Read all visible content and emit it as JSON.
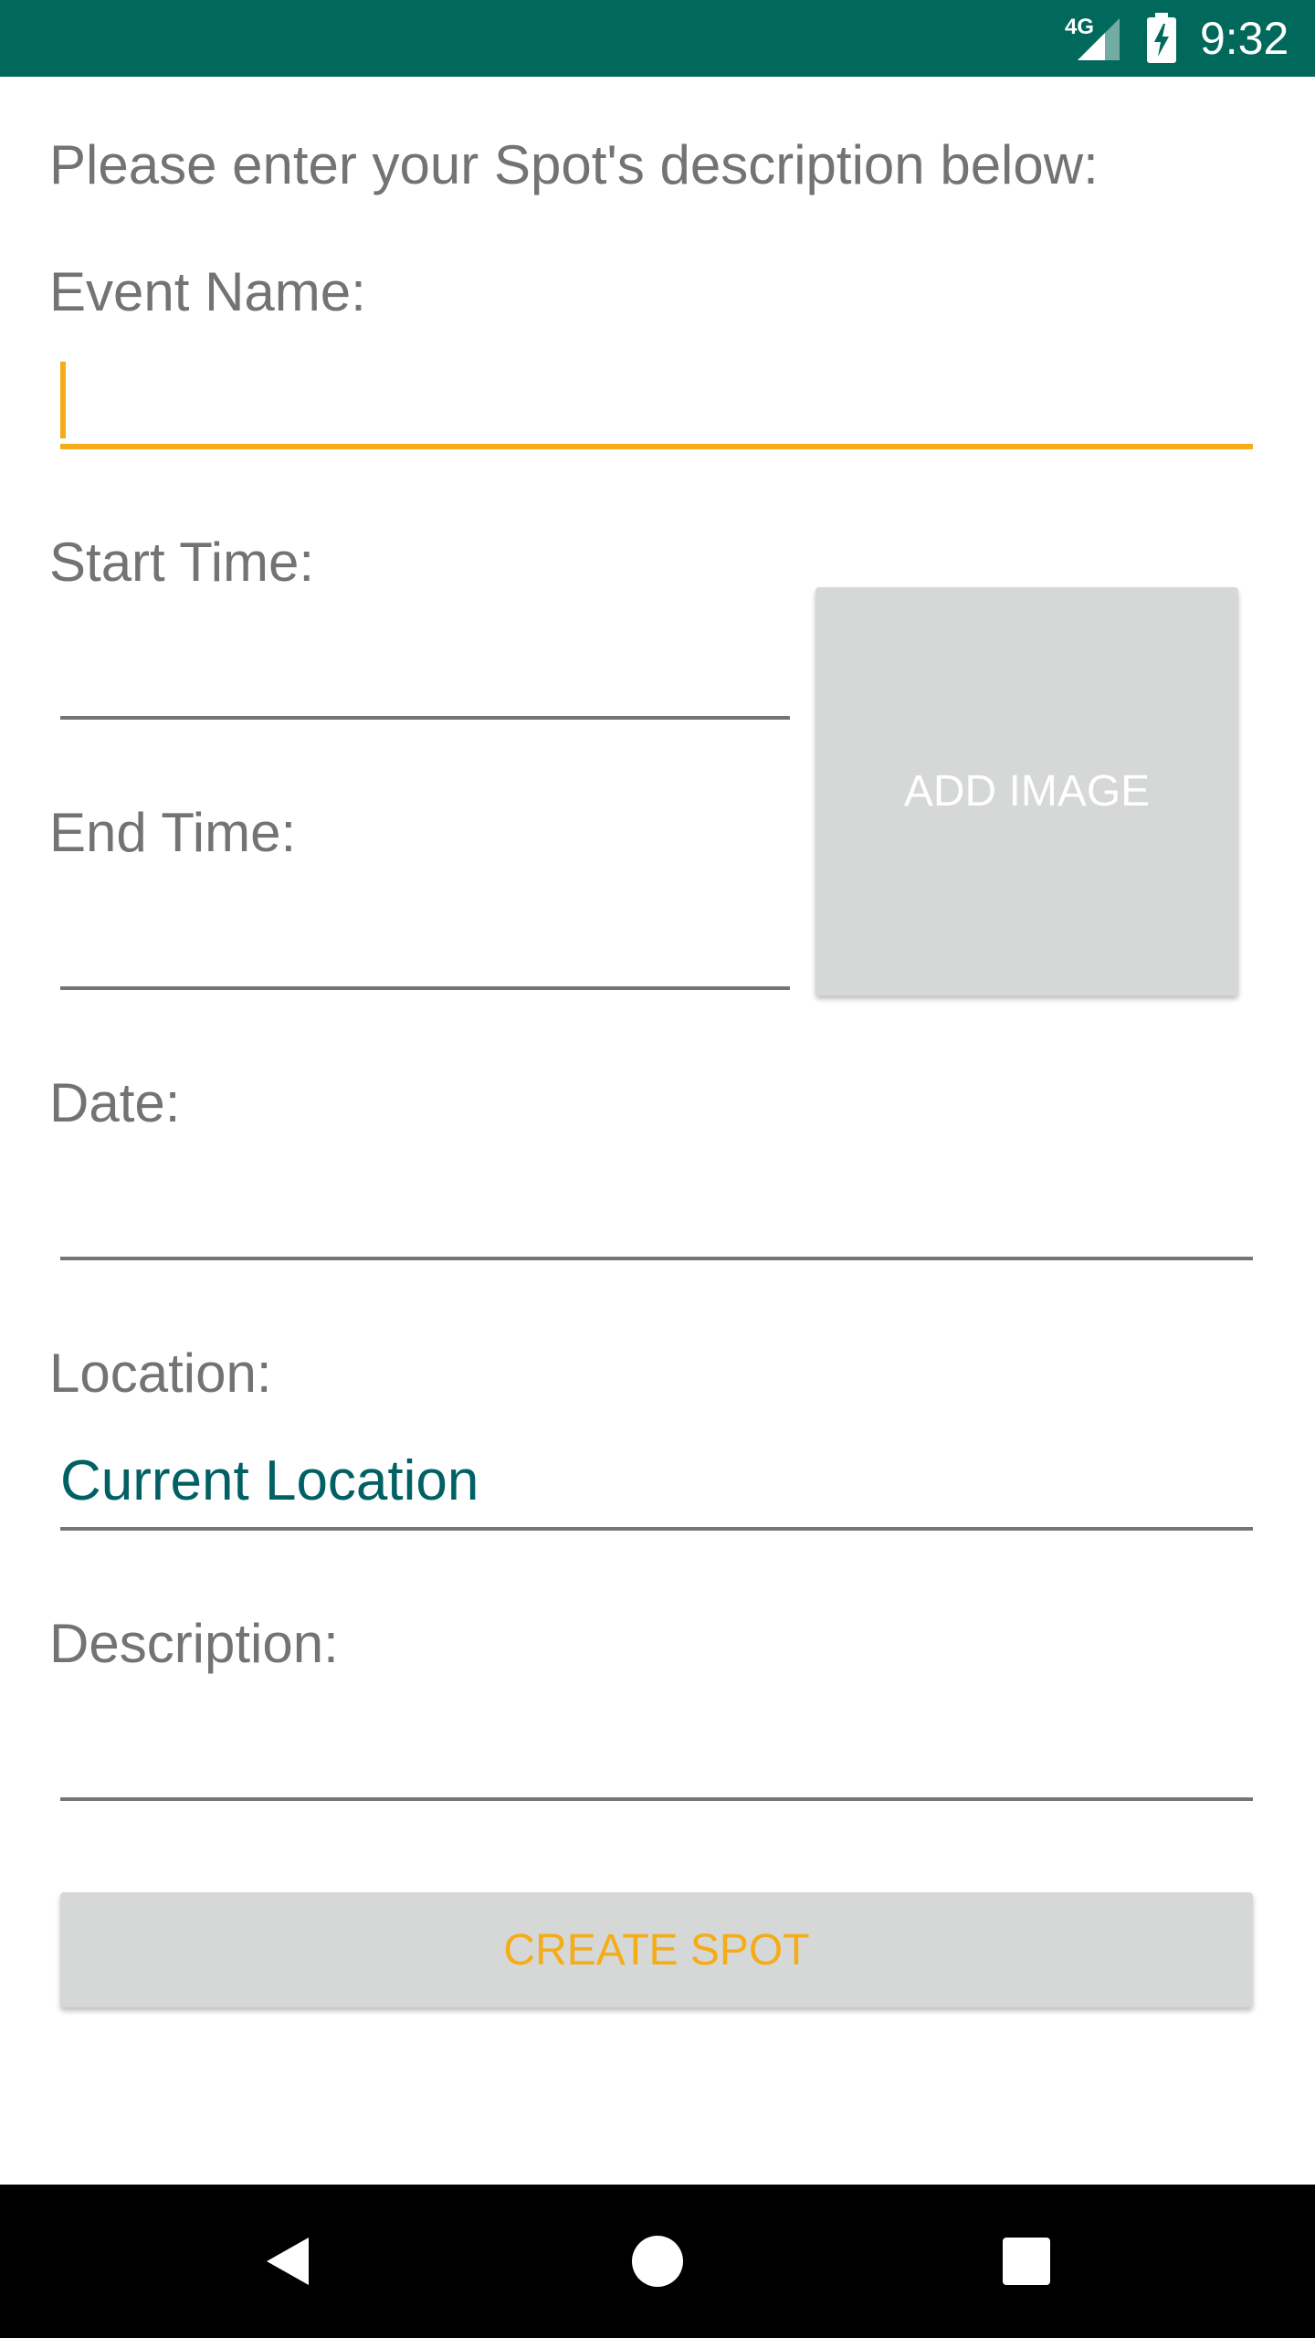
{
  "status_bar": {
    "network": "4G",
    "time": "9:32",
    "background_color": "#00695c",
    "icons": [
      "signal-icon",
      "battery-charging-icon"
    ]
  },
  "form": {
    "intro": "Please enter your Spot's description below:",
    "event_name": {
      "label": "Event Name:",
      "value": ""
    },
    "start_time": {
      "label": "Start Time:",
      "value": ""
    },
    "end_time": {
      "label": "End Time:",
      "value": ""
    },
    "date": {
      "label": "Date:",
      "value": ""
    },
    "location": {
      "label": "Location:",
      "value": "Current Location"
    },
    "description": {
      "label": "Description:",
      "value": ""
    }
  },
  "buttons": {
    "add_image": "ADD IMAGE",
    "create_spot": "CREATE SPOT"
  },
  "nav_bar": {
    "icons": [
      "back-icon",
      "home-icon",
      "recents-icon"
    ]
  },
  "colors": {
    "accent": "#f5ac17",
    "location_text": "#006064",
    "label_text": "#737373",
    "button_bg": "#d6d7d7"
  }
}
